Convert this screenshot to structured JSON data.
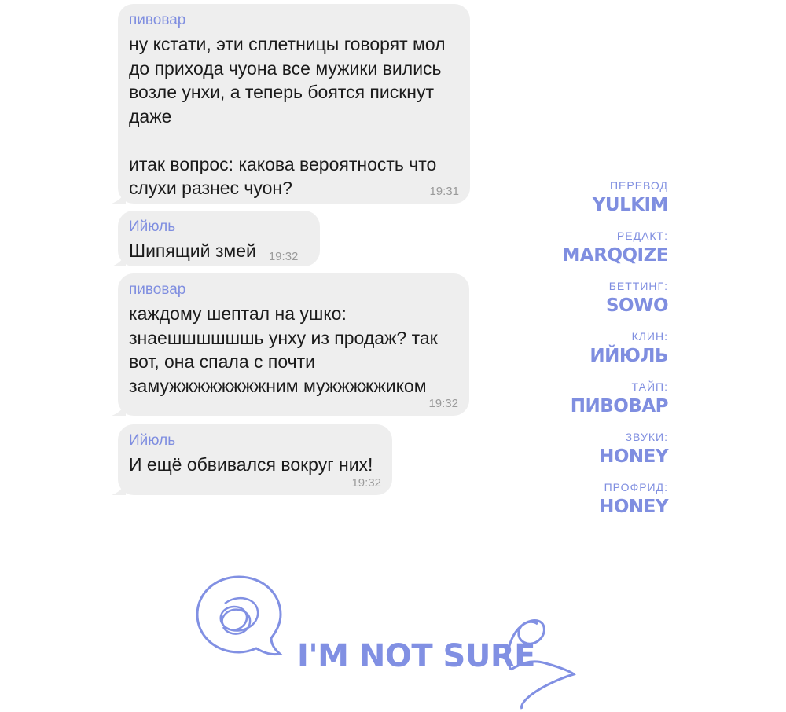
{
  "chat": {
    "messages": [
      {
        "sender": "пивовар",
        "text": "ну кстати, эти сплетницы говорят мол\nдо прихода чуона все мужики вились\nвозле унхи, а теперь боятся пискнут\nдаже\n\nитак вопрос: какова вероятность что\nслухи разнес чуон?",
        "time": "19:31"
      },
      {
        "sender": "Ийюль",
        "text": "Шипящий змей",
        "time": "19:32"
      },
      {
        "sender": "пивовар",
        "text": "каждому шептал на ушко:\nзнаешшшшшшь унху из продаж? так\nвот, она спала с почти\nзамужжжжжжжжним мужжжжжиком",
        "time": "19:32"
      },
      {
        "sender": "Ийюль",
        "text": "И ещё обвивался вокруг них!",
        "time": "19:32"
      }
    ]
  },
  "credits": [
    {
      "role": "ПЕРЕВОД",
      "name": "YULKIM"
    },
    {
      "role": "РЕДАКТ:",
      "name": "MARQQIZE"
    },
    {
      "role": "БЕТТИНГ:",
      "name": "SOWO"
    },
    {
      "role": "КЛИН:",
      "name": "ИЙЮЛЬ"
    },
    {
      "role": "ТАЙП:",
      "name": "ПИВОВАР"
    },
    {
      "role": "ЗВУКИ:",
      "name": "HONEY"
    },
    {
      "role": "ПРОФРИД:",
      "name": "HONEY"
    }
  ],
  "logo": {
    "text": "I'M NOT SURE",
    "icon": "speech-bubble-scribble-icon",
    "decoration": "snake-swirl-icon"
  },
  "colors": {
    "bubble": "#eeeeee",
    "accent": "#7f8ee0",
    "text": "#1b1b1b",
    "time": "#9a9a9a"
  }
}
